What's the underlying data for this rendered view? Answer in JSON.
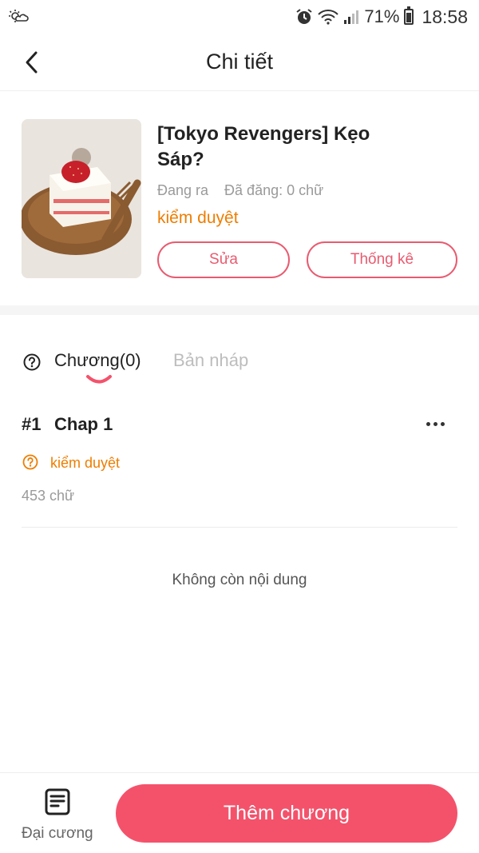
{
  "status_bar": {
    "battery": "71%",
    "time": "18:58",
    "icons": [
      "weather-icon",
      "alarm-icon",
      "wifi-icon",
      "signal-icon",
      "battery-icon"
    ]
  },
  "header": {
    "title": "Chi tiết",
    "back_icon": "chevron-left-icon"
  },
  "book": {
    "title": "[Tokyo Revengers] Kẹo Sáp?",
    "status": "Đang ra",
    "published": "Đã đăng: 0 chữ",
    "review_status": "kiểm duyệt",
    "edit_label": "Sửa",
    "stats_label": "Thống kê",
    "colors": {
      "accent": "#e85b70",
      "warning": "#ee7d00"
    }
  },
  "tabs": {
    "help_icon": "question-circle-icon",
    "chapters_label": "Chương(0)",
    "drafts_label": "Bản nháp"
  },
  "chapters": [
    {
      "number": "#1",
      "title": "Chap 1",
      "status": "kiểm duyệt",
      "words": "453 chữ"
    }
  ],
  "list_end_text": "Không còn nội dung",
  "bottom_bar": {
    "outline_label": "Đại cương",
    "outline_icon": "document-icon",
    "add_chapter_label": "Thêm chương",
    "add_chapter_color": "#f4526b"
  }
}
